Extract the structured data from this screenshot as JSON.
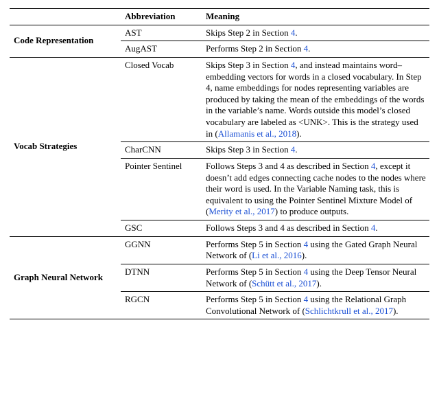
{
  "header": {
    "col1": "",
    "col2": "Abbreviation",
    "col3": "Meaning"
  },
  "groups": [
    {
      "category": "Code Representation",
      "rows": [
        {
          "abbr": "AST",
          "meaning_parts": [
            {
              "text": "Skips Step 2 in Section "
            },
            {
              "text": "4",
              "link": true
            },
            {
              "text": "."
            }
          ]
        },
        {
          "abbr": "AugAST",
          "meaning_parts": [
            {
              "text": "Performs Step 2 in Section "
            },
            {
              "text": "4",
              "link": true
            },
            {
              "text": "."
            }
          ]
        }
      ]
    },
    {
      "category": "Vocab Strategies",
      "rows": [
        {
          "abbr": "Closed Vocab",
          "meaning_parts": [
            {
              "text": "Skips Step 3 in Section "
            },
            {
              "text": "4",
              "link": true
            },
            {
              "text": ", and instead maintains word–embedding vectors for words in a closed vocabulary. In Step 4, name embeddings for nodes representing variables are produced by taking the mean of the embeddings of the words in the variable’s name. Words outside this model’s closed vocabulary are labeled as "
            },
            {
              "text": "<UNK>",
              "sc": true
            },
            {
              "text": ". This is the strategy used in ("
            },
            {
              "text": "Allamanis et al., 2018",
              "link": true
            },
            {
              "text": ")."
            }
          ]
        },
        {
          "abbr": "CharCNN",
          "meaning_parts": [
            {
              "text": "Skips Step 3 in Section "
            },
            {
              "text": "4",
              "link": true
            },
            {
              "text": "."
            }
          ]
        },
        {
          "abbr": "Pointer Sentinel",
          "meaning_parts": [
            {
              "text": "Follows Steps 3 and 4 as described in Section "
            },
            {
              "text": "4",
              "link": true
            },
            {
              "text": ", except it doesn’t add edges connecting cache nodes to the nodes where their word is used. In the Variable Naming task, this is equivalent to using the Pointer Sentinel Mixture Model of ("
            },
            {
              "text": "Merity et al., 2017",
              "link": true
            },
            {
              "text": ") to produce outputs."
            }
          ]
        },
        {
          "abbr": "GSC",
          "meaning_parts": [
            {
              "text": "Follows Steps 3 and 4 as described in Section "
            },
            {
              "text": "4",
              "link": true
            },
            {
              "text": "."
            }
          ]
        }
      ]
    },
    {
      "category": "Graph Neural Network",
      "rows": [
        {
          "abbr": "GGNN",
          "meaning_parts": [
            {
              "text": "Performs Step 5 in Section "
            },
            {
              "text": "4",
              "link": true
            },
            {
              "text": " using the Gated Graph Neural Network of ("
            },
            {
              "text": "Li et al., 2016",
              "link": true
            },
            {
              "text": ")."
            }
          ]
        },
        {
          "abbr": "DTNN",
          "meaning_parts": [
            {
              "text": "Performs Step 5 in Section "
            },
            {
              "text": "4",
              "link": true
            },
            {
              "text": " using the Deep Tensor Neural Network of ("
            },
            {
              "text": "Schütt et al., 2017",
              "link": true
            },
            {
              "text": ")."
            }
          ]
        },
        {
          "abbr": "RGCN",
          "meaning_parts": [
            {
              "text": "Performs Step 5 in Section "
            },
            {
              "text": "4",
              "link": true
            },
            {
              "text": " using the Relational Graph Convolutional Network of ("
            },
            {
              "text": "Schlichtkrull et al., 2017",
              "link": true
            },
            {
              "text": ")."
            }
          ]
        }
      ]
    }
  ]
}
